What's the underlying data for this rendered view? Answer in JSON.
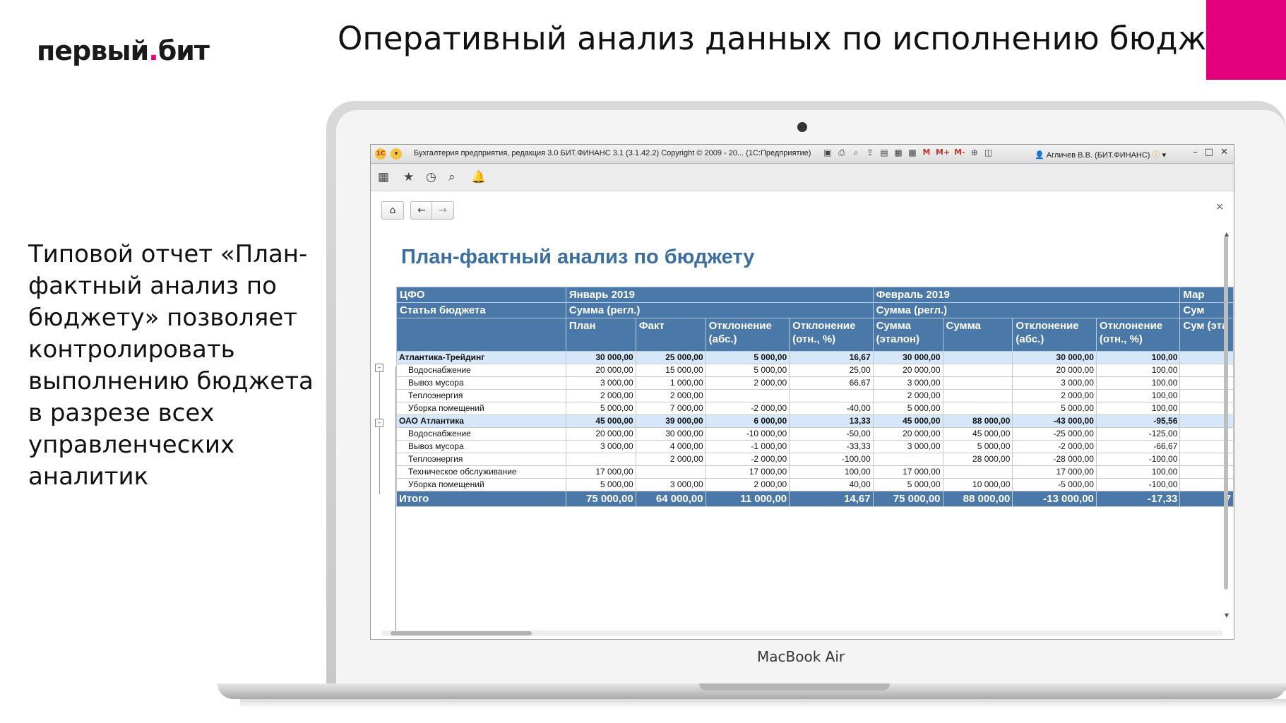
{
  "slide": {
    "logo_text_a": "первый",
    "logo_dot": ".",
    "logo_text_b": "бит",
    "title": "Оперативный анализ данных по исполнению бюджета",
    "description": "Типовой отчет «План-фактный анализ по бюджету» позволяет контролировать выполнению бюджета в разрезе всех управленческих аналитик",
    "accent_color": "#e4007c",
    "laptop_brand": "MacBook Air"
  },
  "app": {
    "title": "Бухгалтерия предприятия, редакция 3.0  БИТ.ФИНАНС 3.1 (3.1.42.2) Copyright © 2009 - 20...  (1С:Предприятие)",
    "user": "Агличев В.В. (БИТ.ФИНАНС)",
    "titlebar_icons": [
      "save-icon",
      "print-icon",
      "preview-icon",
      "upload-icon",
      "doc-icon",
      "table-icon",
      "calendar-icon"
    ],
    "memory_buttons": [
      "M",
      "M+",
      "M-"
    ],
    "window_controls": [
      "minimize-icon",
      "maximize-icon",
      "close-icon"
    ],
    "toolbar_icons": [
      "apps-grid-icon",
      "star-icon",
      "history-icon",
      "search-icon",
      "bell-icon"
    ],
    "nav": {
      "home": "⌂",
      "back": "←",
      "forward": "→",
      "close": "×"
    }
  },
  "report": {
    "title": "План-фактный анализ по бюджету",
    "headers": {
      "row1": [
        "ЦФО",
        "Январь 2019",
        "Февраль 2019",
        "Мар"
      ],
      "row2": [
        "Статья бюджета",
        "Сумма (регл.)",
        "Сумма (регл.)",
        "Сум"
      ],
      "row3": [
        "План",
        "Факт",
        "Отклонение (абс.)",
        "Отклонение (отн., %)",
        "Сумма (эталон)",
        "Сумма",
        "Отклонение (абс.)",
        "Отклонение (отн., %)",
        "Сум (эта"
      ]
    },
    "rows": [
      {
        "type": "grp",
        "name": "Атлантика-Трейдинг",
        "cells": [
          "30 000,00",
          "25 000,00",
          "5 000,00",
          "16,67",
          "30 000,00",
          "",
          "30 000,00",
          "100,00",
          ""
        ]
      },
      {
        "type": "item",
        "name": "Водоснабжение",
        "cells": [
          "20 000,00",
          "15 000,00",
          "5 000,00",
          "25,00",
          "20 000,00",
          "",
          "20 000,00",
          "100,00",
          ""
        ]
      },
      {
        "type": "item",
        "name": "Вывоз мусора",
        "cells": [
          "3 000,00",
          "1 000,00",
          "2 000,00",
          "66,67",
          "3 000,00",
          "",
          "3 000,00",
          "100,00",
          ""
        ]
      },
      {
        "type": "item",
        "name": "Теплоэнергия",
        "cells": [
          "2 000,00",
          "2 000,00",
          "",
          "",
          "2 000,00",
          "",
          "2 000,00",
          "100,00",
          ""
        ]
      },
      {
        "type": "item",
        "name": "Уборка помещений",
        "cells": [
          "5 000,00",
          "7 000,00",
          "-2 000,00",
          "-40,00",
          "5 000,00",
          "",
          "5 000,00",
          "100,00",
          ""
        ]
      },
      {
        "type": "grp",
        "name": "ОАО Атлантика",
        "cells": [
          "45 000,00",
          "39 000,00",
          "6 000,00",
          "13,33",
          "45 000,00",
          "88 000,00",
          "-43 000,00",
          "-95,56",
          ""
        ]
      },
      {
        "type": "item",
        "name": "Водоснабжение",
        "cells": [
          "20 000,00",
          "30 000,00",
          "-10 000,00",
          "-50,00",
          "20 000,00",
          "45 000,00",
          "-25 000,00",
          "-125,00",
          ""
        ]
      },
      {
        "type": "item",
        "name": "Вывоз мусора",
        "cells": [
          "3 000,00",
          "4 000,00",
          "-1 000,00",
          "-33,33",
          "3 000,00",
          "5 000,00",
          "-2 000,00",
          "-66,67",
          ""
        ]
      },
      {
        "type": "item",
        "name": "Теплоэнергия",
        "cells": [
          "",
          "2 000,00",
          "-2 000,00",
          "-100,00",
          "",
          "28 000,00",
          "-28 000,00",
          "-100,00",
          ""
        ]
      },
      {
        "type": "item",
        "name": "Техническое обслуживание",
        "cells": [
          "17 000,00",
          "",
          "17 000,00",
          "100,00",
          "17 000,00",
          "",
          "17 000,00",
          "100,00",
          ""
        ]
      },
      {
        "type": "item",
        "name": "Уборка помещений",
        "cells": [
          "5 000,00",
          "3 000,00",
          "2 000,00",
          "40,00",
          "5 000,00",
          "10 000,00",
          "-5 000,00",
          "-100,00",
          ""
        ]
      },
      {
        "type": "tot",
        "name": "Итого",
        "cells": [
          "75 000,00",
          "64 000,00",
          "11 000,00",
          "14,67",
          "75 000,00",
          "88 000,00",
          "-13 000,00",
          "-17,33",
          "7"
        ]
      }
    ]
  }
}
